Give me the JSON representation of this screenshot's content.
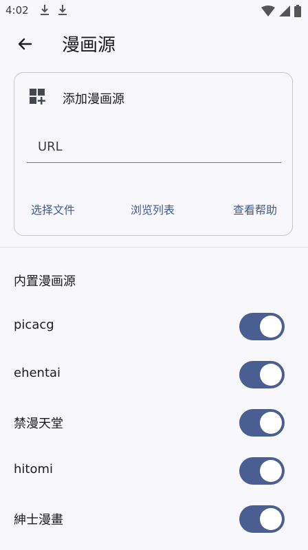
{
  "status_bar": {
    "time": "4:02",
    "icons": [
      "download-icon",
      "download-icon",
      "wifi-icon",
      "signal-icon",
      "battery-icon"
    ]
  },
  "app_bar": {
    "back_icon": "arrow-left-icon",
    "title": "漫画源"
  },
  "add_source": {
    "icon": "widgets-add-icon",
    "title": "添加漫画源",
    "url_placeholder": "URL",
    "actions": {
      "select_file": "选择文件",
      "browse_list": "浏览列表",
      "view_help": "查看帮助"
    }
  },
  "builtin": {
    "section_title": "内置漫画源",
    "sources": [
      {
        "name": "picacg",
        "enabled": true
      },
      {
        "name": "ehentai",
        "enabled": true
      },
      {
        "name": "禁漫天堂",
        "enabled": true
      },
      {
        "name": "hitomi",
        "enabled": true
      },
      {
        "name": "紳士漫畫",
        "enabled": true
      }
    ]
  },
  "colors": {
    "background": "#f8f7fc",
    "accent": "#3f5a94",
    "switch_track": "#4a5e91",
    "switch_thumb": "#ffffff"
  }
}
